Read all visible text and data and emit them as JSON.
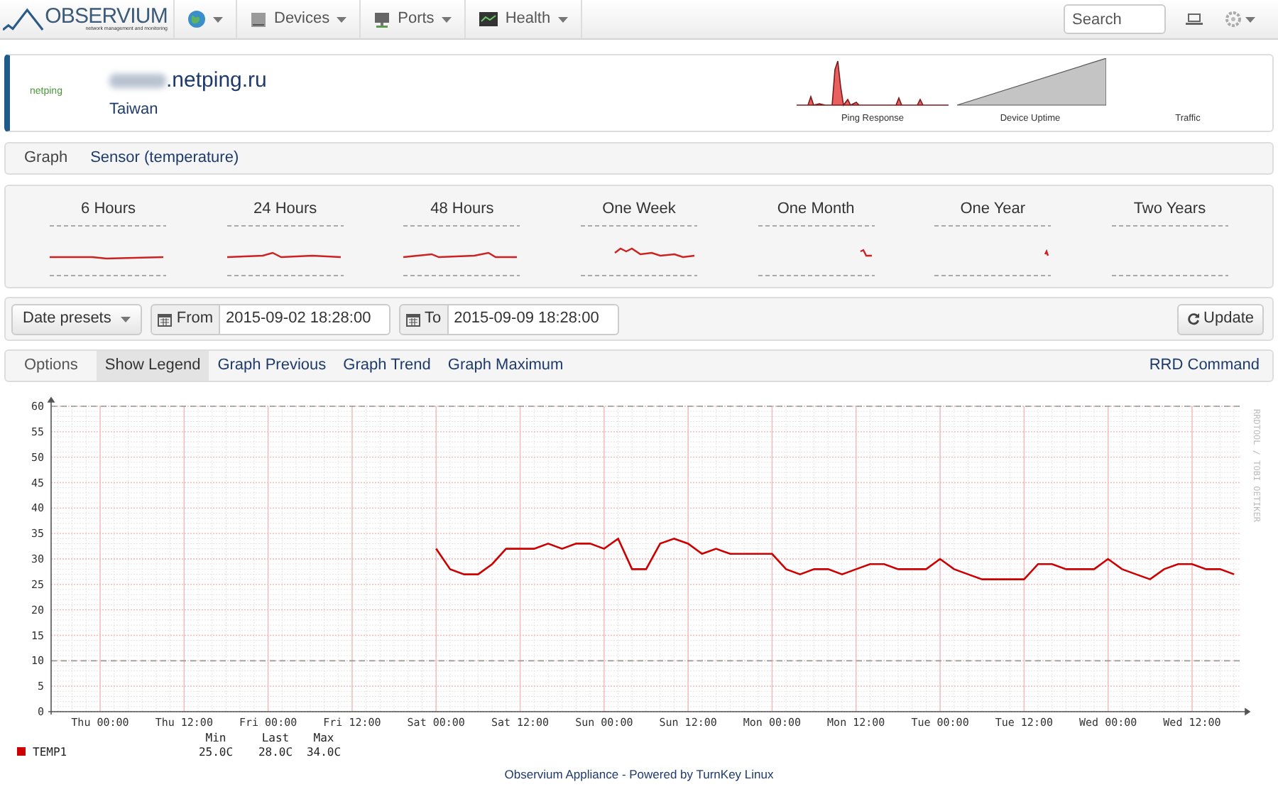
{
  "nav": {
    "brand": "OBSERVIUM",
    "tagline": "network management and monitoring",
    "menus": [
      {
        "kind": "globe"
      },
      {
        "kind": "devices",
        "label": "Devices"
      },
      {
        "kind": "ports",
        "label": "Ports"
      },
      {
        "kind": "health",
        "label": "Health"
      }
    ],
    "search": {
      "placeholder": "Search"
    }
  },
  "device": {
    "vendor": "netping",
    "hostname": ".netping.ru",
    "location": "Taiwan",
    "minigraphs": [
      "Ping Response",
      "Device Uptime",
      "Traffic"
    ]
  },
  "breadcrumb": [
    "Graph",
    "Sensor (temperature)"
  ],
  "periods": [
    {
      "label": "6 Hours"
    },
    {
      "label": "24 Hours"
    },
    {
      "label": "48 Hours"
    },
    {
      "label": "One Week"
    },
    {
      "label": "One Month"
    },
    {
      "label": "One Year"
    },
    {
      "label": "Two Years"
    }
  ],
  "dates": {
    "presets": "Date presets",
    "from_label": "From",
    "from": "2015-09-02 18:28:00",
    "to_label": "To",
    "to": "2015-09-09 18:28:00",
    "update": "Update"
  },
  "options": {
    "label": "Options",
    "items": [
      {
        "label": "Show Legend",
        "selected": true
      },
      {
        "label": "Graph Previous",
        "selected": false
      },
      {
        "label": "Graph Trend",
        "selected": false
      },
      {
        "label": "Graph Maximum",
        "selected": false
      }
    ],
    "rrd": "RRD Command"
  },
  "graph": {
    "side_label": "RRDTOOL / TOBI OETIKER",
    "chart_data": {
      "type": "line",
      "grid": true,
      "ref_lines": [
        {
          "axis": "y",
          "value": 10
        },
        {
          "axis": "y",
          "value": 60
        }
      ],
      "ylim": [
        0,
        60
      ],
      "yticks": [
        0,
        5,
        10,
        15,
        20,
        25,
        30,
        35,
        40,
        45,
        50,
        55,
        60
      ],
      "categories": [
        null,
        null,
        null,
        "Thu 00:00",
        null,
        null,
        null,
        null,
        null,
        "Thu 12:00",
        null,
        null,
        null,
        null,
        null,
        "Fri 00:00",
        null,
        null,
        null,
        null,
        null,
        "Fri 12:00",
        null,
        null,
        null,
        null,
        null,
        "Sat 00:00",
        null,
        null,
        null,
        null,
        null,
        "Sat 12:00",
        null,
        null,
        null,
        null,
        null,
        "Sun 00:00",
        null,
        null,
        null,
        null,
        null,
        "Sun 12:00",
        null,
        null,
        null,
        null,
        null,
        "Mon 00:00",
        null,
        null,
        null,
        null,
        null,
        "Mon 12:00",
        null,
        null,
        null,
        null,
        null,
        "Tue 00:00",
        null,
        null,
        null,
        null,
        null,
        "Tue 12:00",
        null,
        null,
        null,
        null,
        null,
        "Wed 00:00",
        null,
        null,
        null,
        null,
        null,
        "Wed 12:00",
        null,
        null,
        null
      ],
      "series": [
        {
          "name": "TEMP1",
          "color": "#cc0000",
          "values": [
            null,
            null,
            null,
            null,
            null,
            null,
            null,
            null,
            null,
            null,
            null,
            null,
            null,
            null,
            null,
            null,
            null,
            null,
            null,
            null,
            null,
            null,
            null,
            null,
            null,
            null,
            null,
            32,
            28,
            27,
            27,
            29,
            32,
            32,
            32,
            33,
            32,
            33,
            33,
            32,
            34,
            28,
            28,
            33,
            34,
            33,
            31,
            32,
            31,
            31,
            31,
            31,
            28,
            27,
            28,
            28,
            27,
            28,
            29,
            29,
            28,
            28,
            28,
            30,
            28,
            27,
            26,
            26,
            26,
            26,
            29,
            29,
            28,
            28,
            28,
            30,
            28,
            27,
            26,
            28,
            29,
            29,
            28,
            28,
            27
          ]
        }
      ]
    },
    "legend": {
      "columns": [
        "Min",
        "Last",
        "Max"
      ],
      "values": [
        "25.0C",
        "28.0C",
        "34.0C"
      ]
    }
  },
  "footer": {
    "left_link": "Observium Appliance",
    "middle": " - Powered by ",
    "right_link": "TurnKey Linux"
  }
}
